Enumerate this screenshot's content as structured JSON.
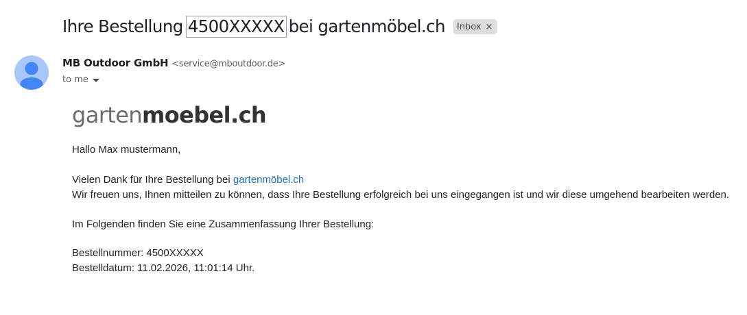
{
  "email": {
    "subject_prefix": "Ihre Bestellung",
    "subject_order_number": "4500XXXXX",
    "subject_suffix": "bei gartenmöbel.ch",
    "label_chip": "Inbox",
    "label_chip_close": "×",
    "sender_name": "MB Outdoor GmbH",
    "sender_email": "<service@mboutdoor.de>",
    "recipient": "to me",
    "avatar_icon": "person-icon"
  },
  "message": {
    "logo_part1": "garten",
    "logo_part2": "moebel.ch",
    "greeting": "Hallo Max mustermann,",
    "thanks_text": "Vielen Dank für Ihre Bestellung bei",
    "shop_link": "gartenmöbel.ch",
    "confirmation": "Wir freuen uns, Ihnen mitteilen zu können, dass Ihre Bestellung erfolgreich bei uns eingegangen ist und wir diese umgehend bearbeiten werden.",
    "summary_intro": "Im Folgenden finden Sie eine Zusammenfassung Ihrer Bestellung:",
    "order_number_line": "Bestellnummer: 4500XXXXX",
    "order_date_line": "Bestelldatum: 11.02.2026, 11:01:14 Uhr."
  },
  "colors": {
    "link": "#1e6fbf",
    "avatar_bg": "#a8c7fa",
    "avatar_fg": "#4285f4"
  }
}
